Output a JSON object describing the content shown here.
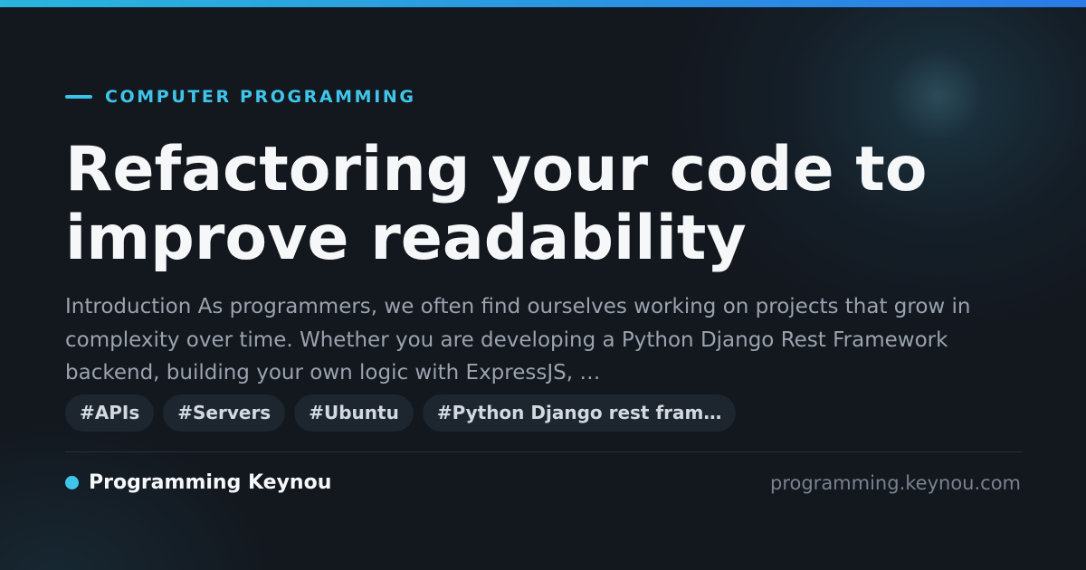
{
  "category": {
    "label": "COMPUTER PROGRAMMING"
  },
  "article": {
    "title": "Refactoring your code to improve readability",
    "excerpt": "Introduction As programmers, we often find ourselves working on projects that grow in complexity over time. Whether you are developing a Python Django Rest Framework backend, building your own logic with ExpressJS, …"
  },
  "tags": [
    {
      "label": "#APIs"
    },
    {
      "label": "#Servers"
    },
    {
      "label": "#Ubuntu"
    },
    {
      "label": "#Python Django rest fram…"
    }
  ],
  "footer": {
    "site_name": "Programming Keynou",
    "site_url": "programming.keynou.com"
  },
  "colors": {
    "accent": "#3ec6ea",
    "background": "#13171e",
    "title": "#f6f7f9",
    "excerpt": "#9aa3ae",
    "tag_background": "#1d252f"
  },
  "icons": {
    "category_marker": "dash-line",
    "site_marker": "filled-circle"
  }
}
